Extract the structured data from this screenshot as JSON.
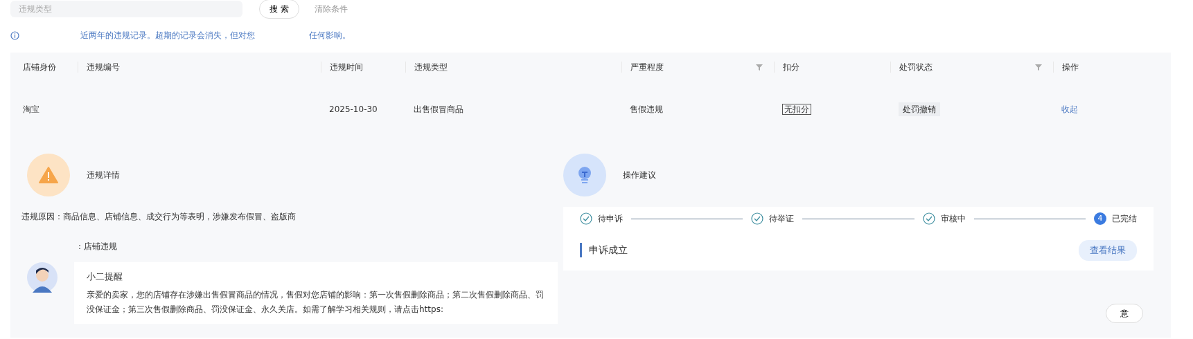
{
  "search": {
    "placeholder": "违规类型"
  },
  "search_button": "搜 索",
  "clear_button": "清除条件",
  "notice": [
    "近两年的违规记录。超期的记录会消失，但对您",
    "任何影响。"
  ],
  "table": {
    "columns": [
      {
        "label": "店铺身份",
        "filter": false
      },
      {
        "label": "违规编号",
        "filter": false
      },
      {
        "label": "违规时间",
        "filter": false
      },
      {
        "label": "违规类型",
        "filter": false
      },
      {
        "label": "严重程度",
        "filter": true
      },
      {
        "label": "扣分",
        "filter": false
      },
      {
        "label": "处罚状态",
        "filter": true
      },
      {
        "label": "操作",
        "filter": false
      }
    ],
    "rows": [
      {
        "shop_identity": "淘宝",
        "date": "2025-10-30",
        "type": "出售假冒商品",
        "severity": "售假违规",
        "deduction": "无扣分",
        "status": "处罚撤销",
        "action": "收起"
      }
    ]
  },
  "details": {
    "title": "违规详情",
    "reason": "违规原因：商品信息、店铺信息、成交行为等表明，涉嫌发布假冒、盗版商",
    "category": "：店铺违规",
    "reminder": {
      "title": "小二提醒",
      "text": "亲爱的卖家，您的店铺存在涉嫌出售假冒商品的情况，售假对您店铺的影响：第一次售假删除商品；第二次售假删除商品、罚没保证金；第三次售假删除商品、罚没保证金、永久关店。如需了解学习相关规则，请点击https:"
    }
  },
  "suggestion": {
    "title": "操作建议",
    "steps": [
      {
        "label": "待申诉",
        "done": true
      },
      {
        "label": "待举证",
        "done": true
      },
      {
        "label": "审核中",
        "done": true
      },
      {
        "label": "已完结",
        "done": false,
        "number": "4"
      }
    ],
    "result": {
      "title": "申诉成立",
      "button": "查看结果"
    },
    "more_button": "意"
  }
}
